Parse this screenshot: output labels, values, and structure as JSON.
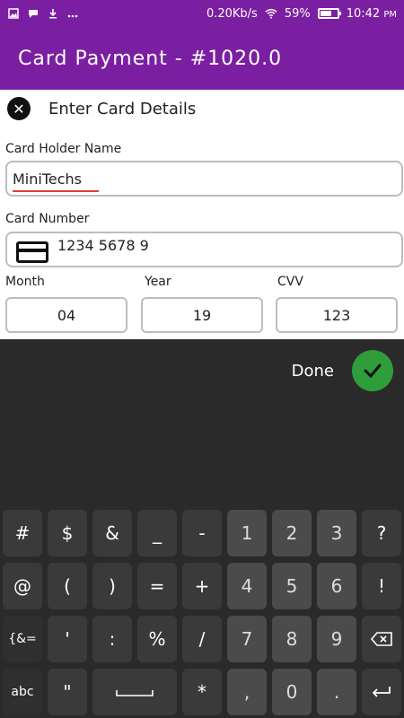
{
  "status_bar": {
    "left_icons": [
      "image-icon",
      "chat-icon",
      "download-icon",
      "more-icon"
    ],
    "network_speed": "0.20Kb/s",
    "battery_percent": "59%",
    "battery_level": 0.59,
    "time": "10:42",
    "ampm": "PM"
  },
  "app_bar": {
    "title": "Card Payment - #1020.0",
    "color": "#7b1fa2"
  },
  "form": {
    "header": "Enter Card Details",
    "card_holder": {
      "label": "Card Holder Name",
      "value": "MiniTechs"
    },
    "card_number": {
      "label": "Card Number",
      "value": "1234 5678 9"
    },
    "month": {
      "label": "Month",
      "value": "04"
    },
    "year": {
      "label": "Year",
      "value": "19"
    },
    "cvv": {
      "label": "CVV",
      "value": "123"
    }
  },
  "keyboard": {
    "done_label": "Done",
    "row1": [
      "#",
      "$",
      "&",
      "_",
      "-",
      "1",
      "2",
      "3",
      "?"
    ],
    "row2": [
      "@",
      "(",
      ")",
      "=",
      "+",
      "4",
      "5",
      "6",
      "!"
    ],
    "row3": [
      "{&=",
      "'",
      ":",
      "%",
      "/",
      "7",
      "8",
      "9"
    ],
    "row4": [
      "abc",
      "\"",
      "",
      "*",
      ",",
      "0",
      "."
    ],
    "accent": "#2e9d3a"
  }
}
